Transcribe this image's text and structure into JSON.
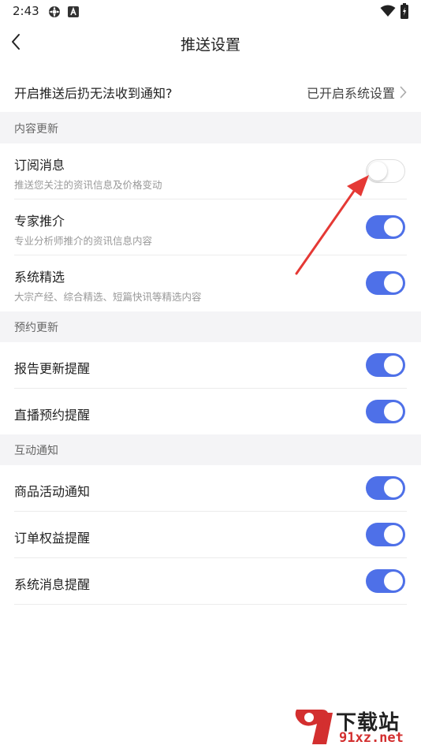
{
  "status_bar": {
    "time": "2:43",
    "icons": [
      "settings-gear-icon",
      "app-a-icon",
      "wifi-icon",
      "battery-charging-icon"
    ]
  },
  "nav": {
    "title": "推送设置",
    "back_icon": "chevron-left-icon"
  },
  "notice": {
    "text": "开启推送后扔无法收到通知?",
    "link_label": "已开启系统设置",
    "link_icon": "chevron-right-icon"
  },
  "sections": [
    {
      "header": "内容更新",
      "items": [
        {
          "title": "订阅消息",
          "subtitle": "推送您关注的资讯信息及价格变动",
          "enabled": false
        },
        {
          "title": "专家推介",
          "subtitle": "专业分析师推介的资讯信息内容",
          "enabled": true
        },
        {
          "title": "系统精选",
          "subtitle": "大宗产经、综合精选、短篇快讯等精选内容",
          "enabled": true
        }
      ]
    },
    {
      "header": "预约更新",
      "items": [
        {
          "title": "报告更新提醒",
          "enabled": true
        },
        {
          "title": "直播预约提醒",
          "enabled": true
        }
      ]
    },
    {
      "header": "互动通知",
      "items": [
        {
          "title": "商品活动通知",
          "enabled": true
        },
        {
          "title": "订单权益提醒",
          "enabled": true
        },
        {
          "title": "系统消息提醒",
          "enabled": true
        }
      ]
    }
  ],
  "watermark": {
    "text": "下载站",
    "domain": "91xz.net"
  },
  "colors": {
    "toggle_on": "#4e70e8",
    "section_bg": "#f4f4f6",
    "annotation_arrow": "#e53935",
    "watermark_red": "#d32f2f"
  }
}
